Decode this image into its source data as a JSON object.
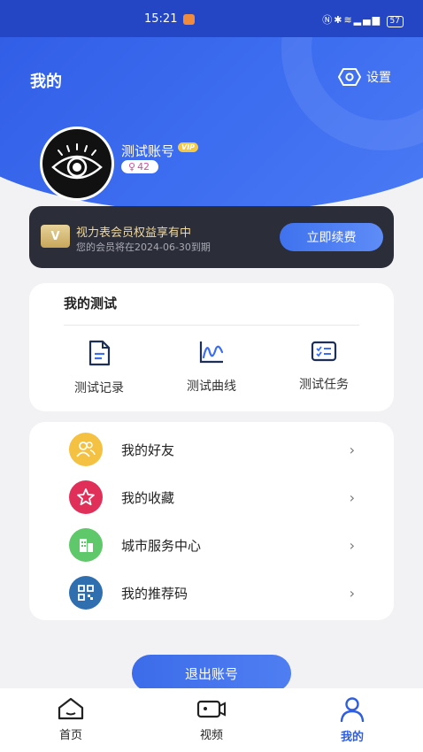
{
  "status": {
    "time": "15:21",
    "battery": "57"
  },
  "header": {
    "title": "我的",
    "settings_label": "设置"
  },
  "profile": {
    "name": "测试账号",
    "vip_badge": "VIP",
    "points": "42"
  },
  "membership": {
    "title": "视力表会员权益享有中",
    "subtitle": "您的会员将在2024-06-30到期",
    "renew_label": "立即续费"
  },
  "tests": {
    "title": "我的测试",
    "items": [
      {
        "label": "测试记录",
        "icon": "document-icon"
      },
      {
        "label": "测试曲线",
        "icon": "curve-chart-icon"
      },
      {
        "label": "测试任务",
        "icon": "task-list-icon"
      }
    ]
  },
  "menu": {
    "items": [
      {
        "label": "我的好友",
        "icon": "friends-icon",
        "color": "#f5c142"
      },
      {
        "label": "我的收藏",
        "icon": "star-icon",
        "color": "#e0305a"
      },
      {
        "label": "城市服务中心",
        "icon": "building-icon",
        "color": "#5fc86a"
      },
      {
        "label": "我的推荐码",
        "icon": "qr-code-icon",
        "color": "#2f6fb0"
      }
    ]
  },
  "logout_label": "退出账号",
  "tabbar": {
    "items": [
      {
        "label": "首页",
        "icon": "home-icon"
      },
      {
        "label": "视频",
        "icon": "video-camera-icon"
      },
      {
        "label": "我的",
        "icon": "profile-icon",
        "active": true
      }
    ]
  },
  "colors": {
    "primary": "#3d6df0",
    "member_bg": "#2b2d38",
    "gold_text": "#f0d9a0"
  }
}
